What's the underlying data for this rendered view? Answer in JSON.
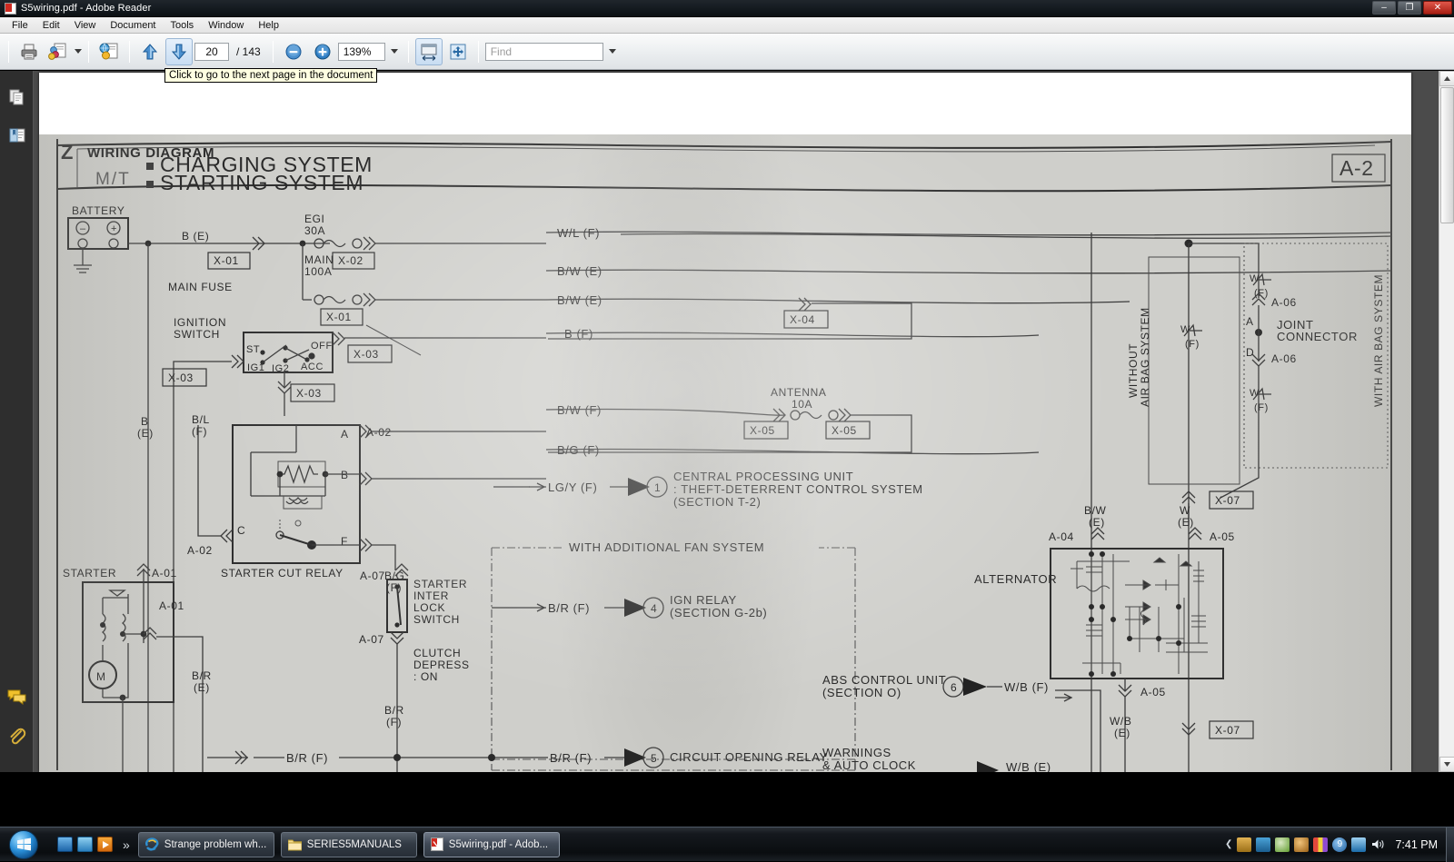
{
  "window": {
    "title": "S5wiring.pdf - Adobe Reader",
    "icon": "pdf-icon",
    "minimize_label": "–",
    "maximize_label": "❐",
    "close_label": "✕"
  },
  "menubar": {
    "items": [
      "File",
      "Edit",
      "View",
      "Document",
      "Tools",
      "Window",
      "Help"
    ]
  },
  "toolbar": {
    "print_icon": "printer-icon",
    "email_icon": "share-document-icon",
    "snapshot_icon": "web-capture-icon",
    "prev_page_icon": "up-arrow-icon",
    "next_page_icon": "down-arrow-icon",
    "page_number": "20",
    "page_total": "/ 143",
    "zoom_out_icon": "zoom-out-icon",
    "zoom_in_icon": "zoom-in-icon",
    "zoom_value": "139%",
    "zoom_dropdown_icon": "chevron-down-icon",
    "fit_width_icon": "fit-width-icon",
    "fit_page_icon": "fit-page-icon",
    "find_placeholder": "Find",
    "find_value": "",
    "find_dropdown_icon": "chevron-down-icon"
  },
  "tooltip": {
    "text": "Click to go to the next page in the document"
  },
  "left_pane": {
    "items": [
      {
        "name": "pages-panel-icon",
        "label": "Pages"
      },
      {
        "name": "bookmarks-panel-icon",
        "label": "Bookmarks"
      },
      {
        "name": "comments-panel-icon",
        "label": "Comments"
      },
      {
        "name": "attachments-panel-icon",
        "label": "Attachments"
      }
    ]
  },
  "document": {
    "page_label": "A-2",
    "header": {
      "mark": "Z",
      "title": "WIRING DIAGRAM",
      "transmission": "M/T",
      "systems": [
        "CHARGING SYSTEM",
        "STARTING SYSTEM"
      ]
    },
    "labels": {
      "battery": "BATTERY",
      "egi": "EGI",
      "egi_amp": "30A",
      "main": "MAIN",
      "main_amp": "100A",
      "main_fuse": "MAIN FUSE",
      "ignition_switch": "IGNITION\nSWITCH",
      "ign_st": "ST",
      "ign_off": "OFF",
      "ign_ig1": "IG1",
      "ign_ig2": "IG2",
      "ign_acc": "ACC",
      "antenna": "ANTENNA",
      "antenna_amp": "10A",
      "starter_cut_relay": "STARTER CUT RELAY",
      "starter": "STARTER",
      "starter_motor": "M",
      "starter_interlock": "STARTER\nINTER\nLOCK\nSWITCH",
      "clutch_depress": "CLUTCH\nDEPRESS\n: ON",
      "with_additional_fan": "WITH ADDITIONAL FAN SYSTEM",
      "alternator": "ALTERNATOR",
      "joint_connector": "JOINT\nCONNECTOR",
      "without_air_bag": "WITHOUT\nAIR BAG SYSTEM",
      "with_air_bag": "WITH AIR BAG SYSTEM",
      "cpu": "CENTRAL PROCESSING UNIT\n: THEFT-DETERRENT CONTROL SYSTEM\n(SECTION T-2)",
      "ign_relay": "IGN RELAY\n(SECTION G-2b)",
      "abs_control_unit": "ABS CONTROL UNIT\n(SECTION O)",
      "circuit_opening_relay": "CIRCUIT OPENING RELAY",
      "warnings": "WARNINGS"
    },
    "connectors": [
      "X-01",
      "X-02",
      "X-01",
      "X-03",
      "X-03",
      "X-03",
      "X-04",
      "X-05",
      "X-05",
      "X-07",
      "X-07"
    ],
    "terminals": [
      "A-02",
      "A-02",
      "A-01",
      "A-01",
      "A-07",
      "A-07",
      "A-04",
      "A-05",
      "A-05",
      "A-06",
      "A-06"
    ],
    "wire_codes": [
      "B (E)",
      "W/L (F)",
      "B/W (E)",
      "B/W (E)",
      "B (F)",
      "B/W (F)",
      "B/G (F)",
      "LG/Y (F)",
      "B/R (F)",
      "B/R (F)",
      "W/B (F)",
      "B\n(E)",
      "B/L\n(F)",
      "B/G\n(F)",
      "B/R\n(E)",
      "B/R\n(F)",
      "B/W\n(E)",
      "W\n(E)",
      "W/B\n(E)",
      "W\n(F)",
      "B/R (F)"
    ],
    "callout_numbers": [
      "1",
      "4",
      "6",
      "5"
    ]
  },
  "taskbar": {
    "start_icon": "windows-start-orb",
    "quick_launch": [
      "show-desktop-icon",
      "switch-windows-icon",
      "media-player-icon"
    ],
    "overflow_icon": "»",
    "tasks": [
      {
        "icon": "internet-explorer-icon",
        "label": "Strange problem wh...",
        "active": false
      },
      {
        "icon": "folder-icon",
        "label": "SERIES5MANUALS",
        "active": false
      },
      {
        "icon": "pdf-icon",
        "label": "S5wiring.pdf - Adob...",
        "active": true
      }
    ],
    "tray_expand_icon": "❮",
    "tray_icons": [
      "printer-tray-icon",
      "utorrent-icon",
      "shield-green-icon",
      "globe-check-icon",
      "colorbars-icon",
      "blue-9-icon",
      "network-icon",
      "volume-icon"
    ],
    "clock": "7:41 PM"
  },
  "colors": {
    "accent_blue": "#2a8fd8",
    "close_red": "#c8291c",
    "tooltip_bg": "#ffffe1",
    "paper": "#cfcfcb",
    "ink": "#2a2a2a"
  }
}
